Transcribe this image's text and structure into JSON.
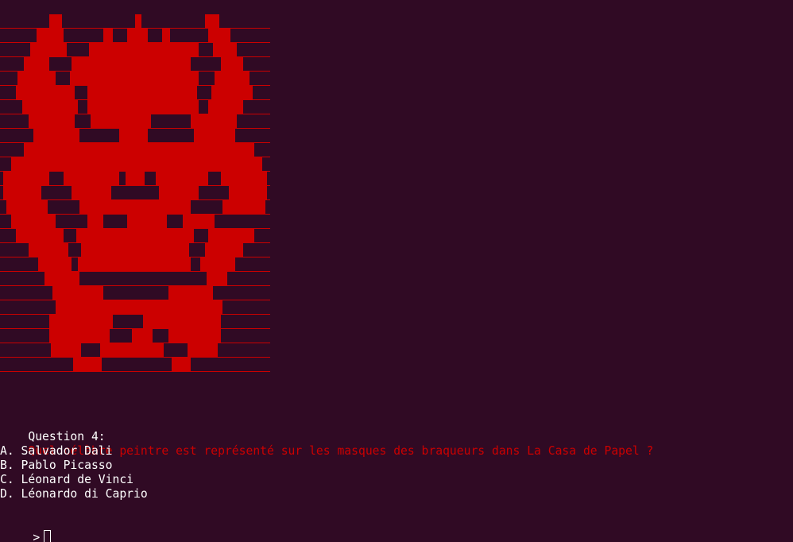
{
  "colors": {
    "background": "#300a24",
    "art": "#cc0000",
    "question_text": "#cc0000",
    "foreground": "#ffffff"
  },
  "ascii_art": {
    "subject": "red pixel-art demon mask (La Casa de Papel style)"
  },
  "question": {
    "label": "Question 4:",
    "text": "Quel célèbre peintre est représenté sur les masques des braqueurs dans La Casa de Papel ?"
  },
  "options": [
    {
      "text": "A. Salvador Dali"
    },
    {
      "text": "B. Pablo Picasso"
    },
    {
      "text": "C. Léonard de Vinci"
    },
    {
      "text": "D. Léonardo di Caprio"
    }
  ],
  "prompt": {
    "symbol": ">"
  }
}
